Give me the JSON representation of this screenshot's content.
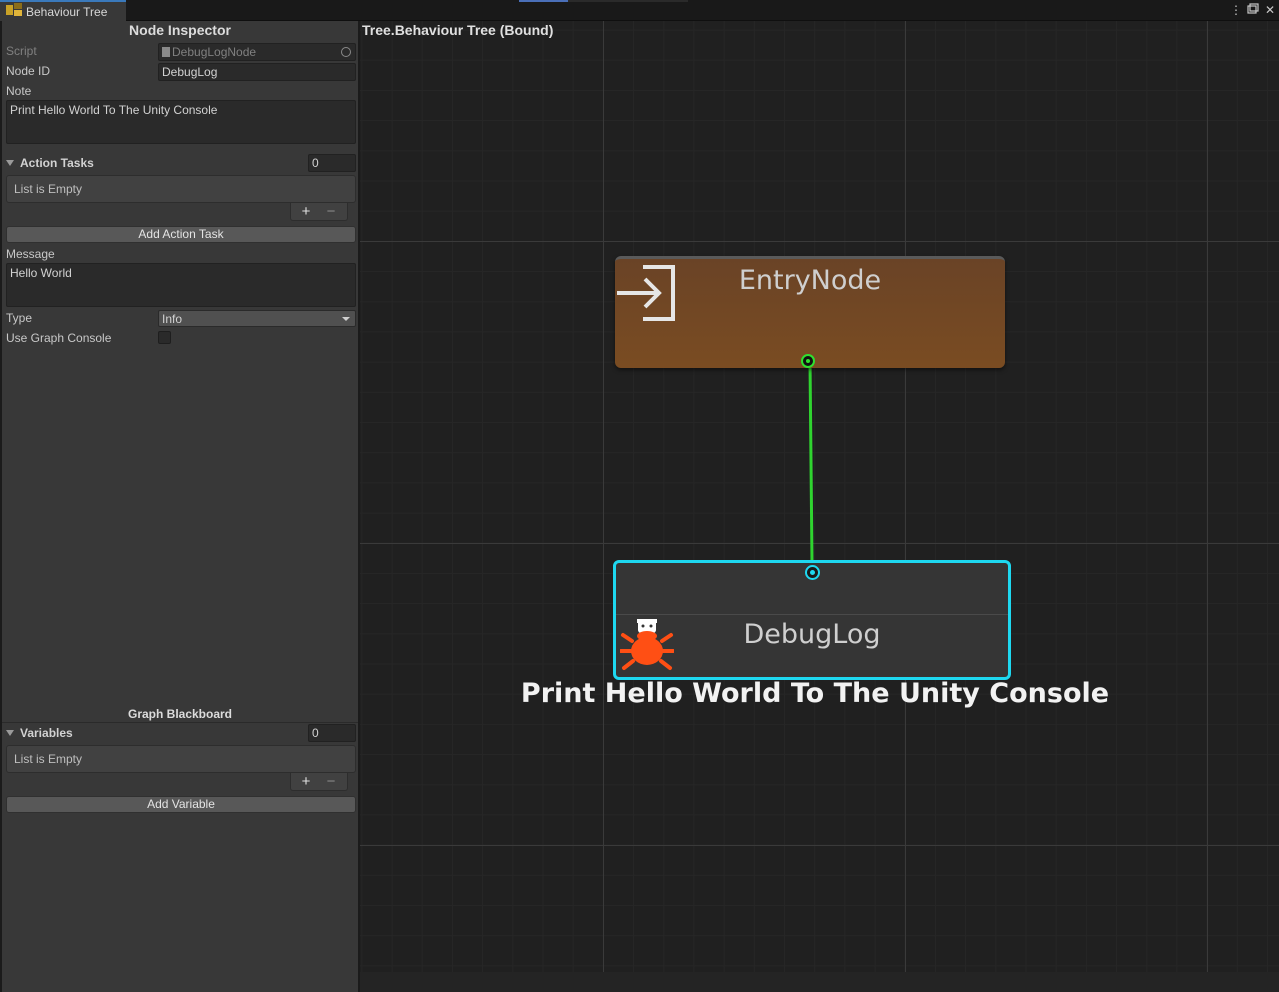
{
  "window": {
    "tab_label": "Behaviour Tree",
    "menu_icon": "kebab-menu-icon",
    "maximize_icon": "maximize-icon",
    "close_icon": "close-icon"
  },
  "inspector": {
    "title": "Node Inspector",
    "script_label": "Script",
    "script_value": "DebugLogNode",
    "node_id_label": "Node ID",
    "node_id_value": "DebugLog",
    "note_label": "Note",
    "note_value": "Print Hello World To The Unity Console",
    "action_tasks_label": "Action Tasks",
    "action_tasks_count": "0",
    "action_tasks_empty": "List is Empty",
    "add_action_task": "Add Action Task",
    "message_label": "Message",
    "message_value": "Hello World",
    "type_label": "Type",
    "type_value": "Info",
    "use_graph_console_label": "Use Graph Console",
    "use_graph_console_checked": false
  },
  "blackboard": {
    "title": "Graph Blackboard",
    "variables_label": "Variables",
    "variables_count": "0",
    "variables_empty": "List is Empty",
    "add_variable": "Add Variable"
  },
  "graph": {
    "title": "Tree.Behaviour Tree (Bound)",
    "entry_node": {
      "title": "EntryNode",
      "icon": "enter-arrow-icon"
    },
    "debug_node": {
      "title": "DebugLog",
      "icon": "bug-icon",
      "note": "Print Hello World To The Unity Console"
    },
    "colors": {
      "entry_node": "#7a4c22",
      "selection": "#1ed8f0",
      "connection": "#2fe02f",
      "bug_icon": "#ff4f14"
    }
  }
}
